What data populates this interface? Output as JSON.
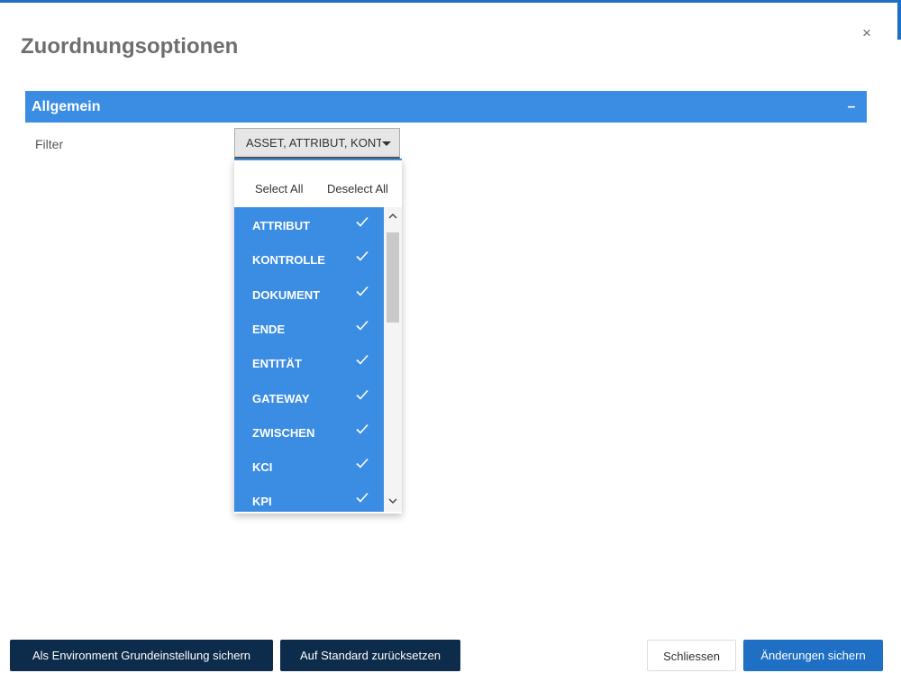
{
  "dialog": {
    "title": "Zuordnungsoptionen",
    "close_label": "×"
  },
  "section": {
    "title": "Allgemein",
    "collapse_label": "–"
  },
  "filter": {
    "label": "Filter",
    "selected_text": "ASSET, ATTRIBUT, KONTROLLE"
  },
  "dropdown": {
    "select_all": "Select All",
    "deselect_all": "Deselect All",
    "items": [
      {
        "label": "ATTRIBUT",
        "checked": true
      },
      {
        "label": "KONTROLLE",
        "checked": true
      },
      {
        "label": "DOKUMENT",
        "checked": true
      },
      {
        "label": "ENDE",
        "checked": true
      },
      {
        "label": "ENTITÄT",
        "checked": true
      },
      {
        "label": "GATEWAY",
        "checked": true
      },
      {
        "label": "ZWISCHEN",
        "checked": true
      },
      {
        "label": "KCI",
        "checked": true
      },
      {
        "label": "KPI",
        "checked": true
      }
    ]
  },
  "footer": {
    "save_env_default": "Als Environment Grundeinstellung sichern",
    "reset_default": "Auf Standard zurücksetzen",
    "close": "Schliessen",
    "save_changes": "Änderungen sichern"
  },
  "colors": {
    "accent": "#3b8de3",
    "primary_button": "#1f6fc5",
    "dark_button": "#0d2b4a"
  }
}
